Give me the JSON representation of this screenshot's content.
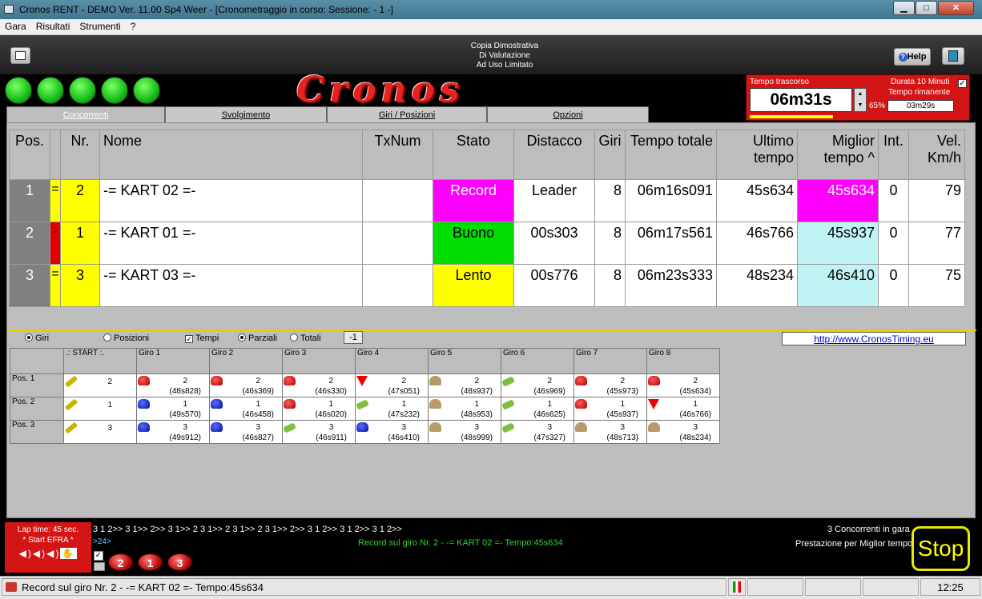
{
  "window": {
    "title": "Cronos RENT - DEMO Ver. 11.00 Sp4 Weer - [Cronometraggio in corso: Sessione: - 1 -]"
  },
  "menu": [
    "Gara",
    "Risultati",
    "Strumenti",
    "?"
  ],
  "toolbar": {
    "demo_line1": "Copia Dimostrativa",
    "demo_line2": "Di Valutazione",
    "demo_line3": "Ad Uso Limitato",
    "help_label": "Help"
  },
  "header": {
    "logo_text": "Cronos",
    "elapsed_label": "Tempo trascorso",
    "elapsed_value": "06m31s",
    "duration_label": "Durata 10 Minuti",
    "remaining_label": "Tempo rimanente",
    "remaining_value": "03m29s",
    "percent": "65%",
    "progress_fraction": 0.65
  },
  "tabs": [
    "Concorrenti",
    "Svolgimento",
    "Giri / Posizioni",
    "Opzioni"
  ],
  "standings": {
    "columns": [
      "Pos.",
      "",
      "Nr.",
      "Nome",
      "TxNum",
      "Stato",
      "Distacco",
      "Giri",
      "Tempo totale",
      "Ultimo tempo",
      "Miglior tempo ^",
      "Int.",
      "Vel. Km/h"
    ],
    "rows": [
      {
        "pos": "1",
        "trend": "=",
        "nr": "2",
        "name": "-= KART 02 =-",
        "tx": "",
        "state": "Record",
        "gap": "Leader",
        "laps": "8",
        "total": "06m16s091",
        "last": "45s634",
        "best": "45s634",
        "int": "0",
        "speed": "79",
        "state_color": "#ff00ff",
        "best_color": "#ff00ff",
        "trend_color": "#ffff00"
      },
      {
        "pos": "2",
        "trend": "-",
        "nr": "1",
        "name": "-= KART 01 =-",
        "tx": "",
        "state": "Buono",
        "gap": "00s303",
        "laps": "8",
        "total": "06m17s561",
        "last": "46s766",
        "best": "45s937",
        "int": "0",
        "speed": "77",
        "state_color": "#00dd00",
        "best_color": "#c0f4f4",
        "trend_color": "#e00000"
      },
      {
        "pos": "3",
        "trend": "=",
        "nr": "3",
        "name": "-= KART 03 =-",
        "tx": "",
        "state": "Lento",
        "gap": "00s776",
        "laps": "8",
        "total": "06m23s333",
        "last": "48s234",
        "best": "46s410",
        "int": "0",
        "speed": "75",
        "state_color": "#ffff00",
        "best_color": "#c0f4f4",
        "trend_color": "#ffff00"
      }
    ]
  },
  "options": {
    "giri": "Giri",
    "posizioni": "Posizioni",
    "tempi": "Tempi",
    "parziali": "Parziali",
    "totali": "Totali",
    "step": "-1",
    "url": "http://www.CronosTiming.eu"
  },
  "laps_grid": {
    "headers": [
      ".: START :.",
      "Giro 1",
      "Giro 2",
      "Giro 3",
      "Giro 4",
      "Giro 5",
      "Giro 6",
      "Giro 7",
      "Giro 8"
    ],
    "rows": [
      {
        "label": "Pos. 1",
        "cells": [
          {
            "icon": "start-flag-icon",
            "top": "2",
            "bottom": ""
          },
          {
            "icon": "red-helmet-icon",
            "top": "2",
            "bottom": "(48s828)"
          },
          {
            "icon": "red-helmet-icon",
            "top": "2",
            "bottom": "(46s369)"
          },
          {
            "icon": "red-helmet-icon",
            "top": "2",
            "bottom": "(46s330)"
          },
          {
            "icon": "down-arrow-icon",
            "top": "2",
            "bottom": "(47s051)"
          },
          {
            "icon": "turtle-icon",
            "top": "2",
            "bottom": "(48s937)"
          },
          {
            "icon": "green-badge-icon",
            "top": "2",
            "bottom": "(46s969)"
          },
          {
            "icon": "red-helmet-icon",
            "top": "2",
            "bottom": "(45s973)"
          },
          {
            "icon": "red-helmet-icon",
            "top": "2",
            "bottom": "(45s634)"
          }
        ]
      },
      {
        "label": "Pos. 2",
        "cells": [
          {
            "icon": "start-flag-icon",
            "top": "1",
            "bottom": ""
          },
          {
            "icon": "blue-helmet-icon",
            "top": "1",
            "bottom": "(49s570)"
          },
          {
            "icon": "blue-helmet-icon",
            "top": "1",
            "bottom": "(46s458)"
          },
          {
            "icon": "red-helmet-icon",
            "top": "1",
            "bottom": "(46s020)"
          },
          {
            "icon": "green-badge-icon",
            "top": "1",
            "bottom": "(47s232)"
          },
          {
            "icon": "turtle-icon",
            "top": "1",
            "bottom": "(48s953)"
          },
          {
            "icon": "green-badge-icon",
            "top": "1",
            "bottom": "(46s625)"
          },
          {
            "icon": "red-helmet-icon",
            "top": "1",
            "bottom": "(45s937)"
          },
          {
            "icon": "down-arrow-icon",
            "top": "1",
            "bottom": "(46s766)"
          }
        ]
      },
      {
        "label": "Pos. 3",
        "cells": [
          {
            "icon": "start-flag-icon",
            "top": "3",
            "bottom": ""
          },
          {
            "icon": "blue-helmet-icon",
            "top": "3",
            "bottom": "(49s912)"
          },
          {
            "icon": "blue-helmet-icon",
            "top": "3",
            "bottom": "(46s827)"
          },
          {
            "icon": "green-badge-icon",
            "top": "3",
            "bottom": "(46s911)"
          },
          {
            "icon": "blue-helmet-icon",
            "top": "3",
            "bottom": "(46s410)"
          },
          {
            "icon": "turtle-icon",
            "top": "3",
            "bottom": "(48s999)"
          },
          {
            "icon": "green-badge-icon",
            "top": "3",
            "bottom": "(47s327)"
          },
          {
            "icon": "turtle-icon",
            "top": "3",
            "bottom": "(48s713)"
          },
          {
            "icon": "turtle-icon",
            "top": "3",
            "bottom": "(48s234)"
          }
        ]
      }
    ]
  },
  "bottom": {
    "lap_time": "Lap time: 45 sec.",
    "start_efra": "* Start EFRA *",
    "sequence": "3 1 2>> 3 1>> 2>> 3 1>> 2 3 1>> 2 3 1>> 2 3 1>> 2>> 3 1 2>> 3 1 2>> 3 1 2>>",
    "sequence2": ">24>",
    "record_msg": "Record sul giro Nr. 2 - -= KART 02 =- Tempo:45s634",
    "competitors": "3 Concorrenti in gara",
    "performance": "Prestazione per Miglior tempo",
    "stop_label": "Stop",
    "kart_buttons": [
      "2",
      "1",
      "3"
    ]
  },
  "statusbar": {
    "message": "Record sul giro Nr. 2 - -= KART 02 =- Tempo:45s634",
    "clock": "12:25"
  }
}
